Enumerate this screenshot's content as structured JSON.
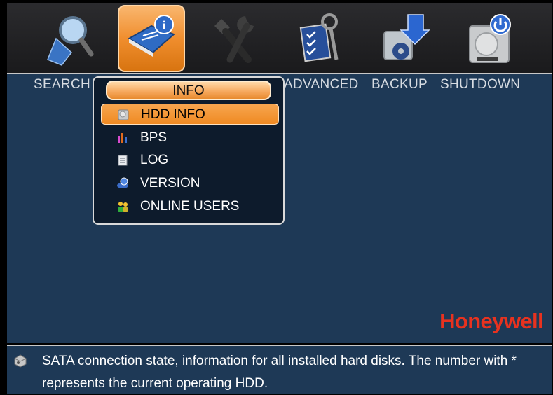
{
  "toolbar": {
    "labels": {
      "search": "SEARCH",
      "advanced": "ADVANCED",
      "backup": "BACKUP",
      "shutdown": "SHUTDOWN"
    }
  },
  "menu": {
    "title": "INFO",
    "items": [
      {
        "label": "HDD INFO",
        "icon": "hdd-icon",
        "selected": true
      },
      {
        "label": "BPS",
        "icon": "bar-chart-icon",
        "selected": false
      },
      {
        "label": "LOG",
        "icon": "log-icon",
        "selected": false
      },
      {
        "label": "VERSION",
        "icon": "version-icon",
        "selected": false
      },
      {
        "label": "ONLINE USERS",
        "icon": "users-icon",
        "selected": false
      }
    ]
  },
  "brand": "Honeywell",
  "status": {
    "text": "SATA connection state, information for all installed hard disks. The number with * represents the current operating HDD."
  },
  "colors": {
    "panel": "#1e3956",
    "accent": "#f08e2e",
    "brand": "#e8321f"
  }
}
